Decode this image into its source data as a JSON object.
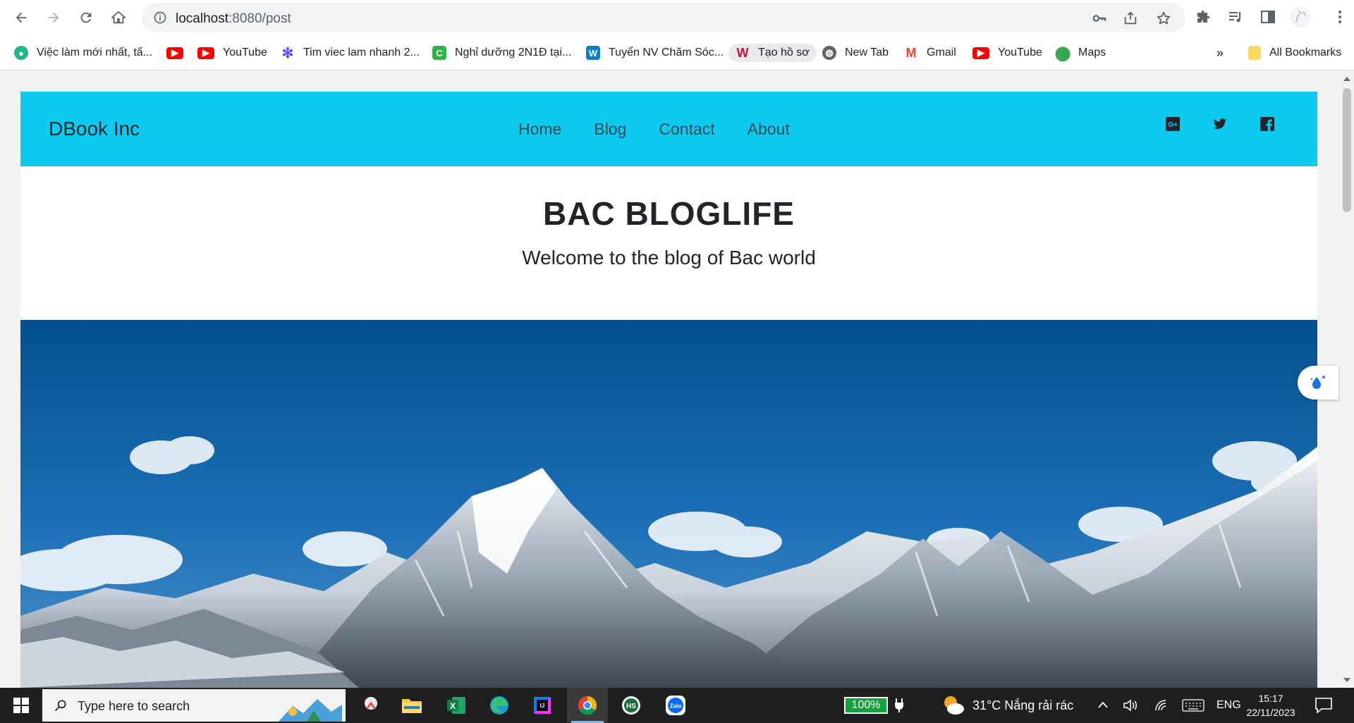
{
  "browser": {
    "url_host": "localhost",
    "url_path": ":8080/post",
    "bookmarks": [
      {
        "label": "Việc làm mới nhất, tấ...",
        "icon": "map-pin-icon",
        "color": "#1fb68a"
      },
      {
        "label": "",
        "icon": "youtube-icon",
        "color": "#ff0000"
      },
      {
        "label": "YouTube",
        "icon": "youtube-icon",
        "color": "#ff0000"
      },
      {
        "label": "Tim viec lam nhanh 2...",
        "icon": "sparkle-icon",
        "color": "#6a4cff"
      },
      {
        "label": "Nghỉ dưỡng 2N1Đ tại...",
        "icon": "c-icon",
        "color": "#2cb34a"
      },
      {
        "label": "Tuyển NV Chăm Sóc...",
        "icon": "w-icon",
        "color": "#0a7fc4"
      },
      {
        "label": "Tạo hồ sơ",
        "icon": "v-icon",
        "color": "#d0103a"
      },
      {
        "label": "New Tab",
        "icon": "globe-icon",
        "color": "#5f6368"
      },
      {
        "label": "Gmail",
        "icon": "gmail-icon",
        "color": "#ea4335"
      },
      {
        "label": "YouTube",
        "icon": "youtube-icon",
        "color": "#ff0000"
      },
      {
        "label": "Maps",
        "icon": "maps-icon",
        "color": "#34a853"
      }
    ],
    "more_label": "»",
    "all_bookmarks": "All Bookmarks"
  },
  "site": {
    "brand": "DBook Inc",
    "nav": [
      "Home",
      "Blog",
      "Contact",
      "About"
    ],
    "social": [
      "google-plus-icon",
      "twitter-icon",
      "facebook-icon"
    ],
    "title": "BAC BLOGLIFE",
    "subtitle": "Welcome to the blog of Bac world",
    "header_color": "#0dcaf0"
  },
  "taskbar": {
    "search_placeholder": "Type here to search",
    "apps": [
      "snipping-tool-icon",
      "file-explorer-icon",
      "excel-icon",
      "edge-icon",
      "intellij-icon",
      "chrome-icon",
      "hs-icon",
      "zalo-icon"
    ],
    "battery": "100%",
    "weather": "31°C  Nắng rải rác",
    "language": "ENG",
    "time": "15:17",
    "date": "22/11/2023"
  }
}
